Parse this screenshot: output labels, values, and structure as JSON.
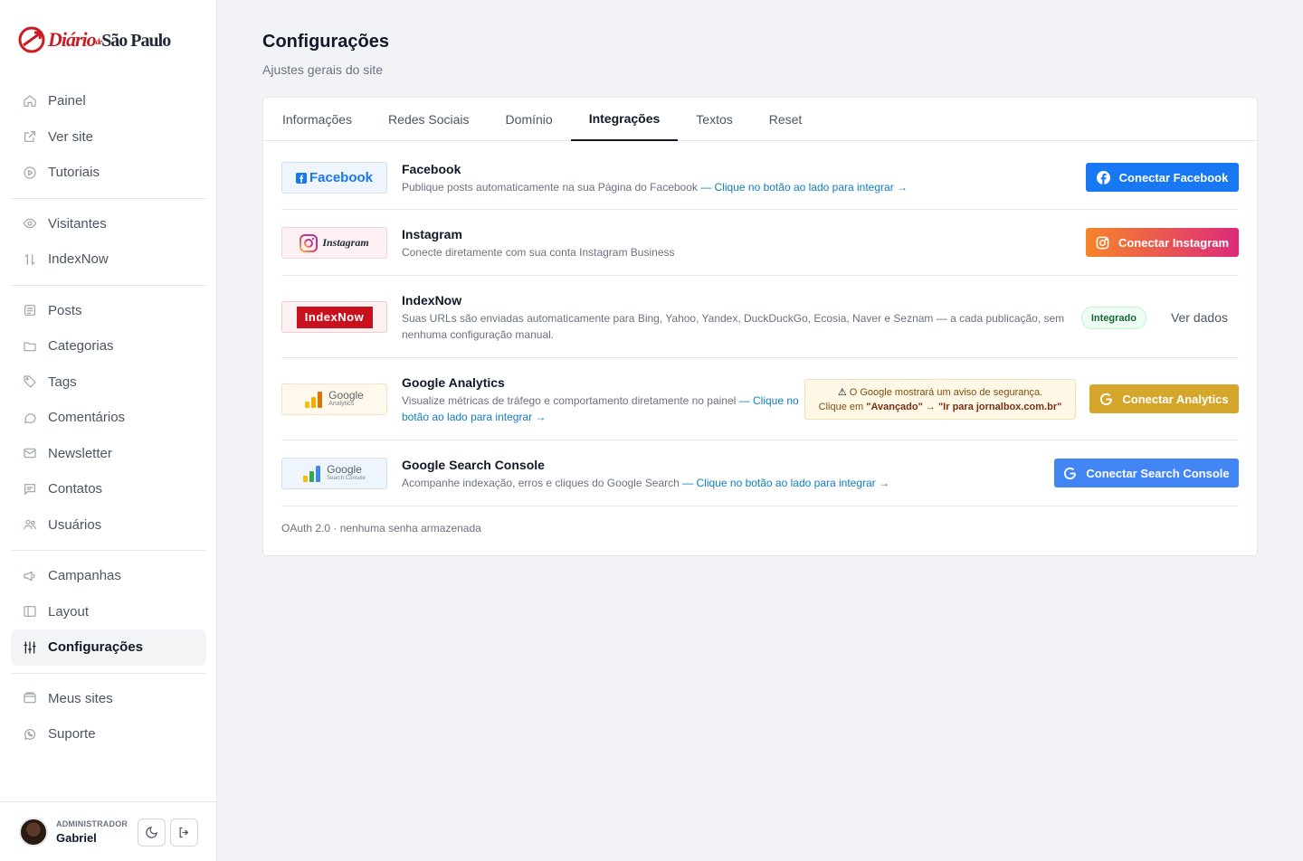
{
  "brand": {
    "name": "Diário",
    "connector": "de",
    "city": "São Paulo"
  },
  "nav": {
    "groups": [
      [
        {
          "label": "Painel",
          "icon": "home-icon"
        },
        {
          "label": "Ver site",
          "icon": "external-link-icon"
        },
        {
          "label": "Tutoriais",
          "icon": "play-circle-icon"
        }
      ],
      [
        {
          "label": "Visitantes",
          "icon": "eye-icon"
        },
        {
          "label": "IndexNow",
          "icon": "sort-arrows-icon"
        }
      ],
      [
        {
          "label": "Posts",
          "icon": "list-icon"
        },
        {
          "label": "Categorias",
          "icon": "folder-icon"
        },
        {
          "label": "Tags",
          "icon": "tag-icon"
        },
        {
          "label": "Comentários",
          "icon": "comment-icon"
        },
        {
          "label": "Newsletter",
          "icon": "mail-icon"
        },
        {
          "label": "Contatos",
          "icon": "message-square-icon"
        },
        {
          "label": "Usuários",
          "icon": "users-icon"
        }
      ],
      [
        {
          "label": "Campanhas",
          "icon": "megaphone-icon"
        },
        {
          "label": "Layout",
          "icon": "layout-icon"
        },
        {
          "label": "Configurações",
          "icon": "sliders-icon",
          "active": true
        }
      ],
      [
        {
          "label": "Meus sites",
          "icon": "browser-icon"
        },
        {
          "label": "Suporte",
          "icon": "whatsapp-icon"
        }
      ]
    ]
  },
  "user": {
    "role": "ADMINISTRADOR",
    "name": "Gabriel"
  },
  "page": {
    "title": "Configurações",
    "subtitle": "Ajustes gerais do site"
  },
  "tabs": [
    {
      "label": "Informações"
    },
    {
      "label": "Redes Sociais"
    },
    {
      "label": "Domínio"
    },
    {
      "label": "Integrações",
      "active": true
    },
    {
      "label": "Textos"
    },
    {
      "label": "Reset"
    }
  ],
  "integrations": {
    "facebook": {
      "badge": "Facebook",
      "title": "Facebook",
      "desc": "Publique posts automaticamente na sua Página do Facebook ",
      "link": "— Clique no botão ao lado para integrar →",
      "button": "Conectar Facebook",
      "color": "#1877f2"
    },
    "instagram": {
      "badge": "Instagram",
      "title": "Instagram",
      "desc": "Conecte diretamente com sua conta Instagram Business",
      "button": "Conectar Instagram"
    },
    "indexnow": {
      "badge": "IndexNow",
      "title": "IndexNow",
      "desc": "Suas URLs são enviadas automaticamente para Bing, Yahoo, Yandex, DuckDuckGo, Ecosia, Naver e Seznam — a cada publicação, sem nenhuma configuração manual.",
      "status": "Integrado",
      "action": "Ver dados"
    },
    "analytics": {
      "badge_brand": "Google",
      "badge_product": "Analytics",
      "title": "Google Analytics",
      "desc": "Visualize métricas de tráfego e comportamento diretamente no painel ",
      "link": "— Clique no botão ao lado para integrar →",
      "warning_line1": "O Google mostrará um aviso de segurança.",
      "warning_prefix": "Clique em ",
      "warning_step1": "\"Avançado\"",
      "warning_arrow": " → ",
      "warning_step2": "\"Ir para jornalbox.com.br\"",
      "button": "Conectar Analytics",
      "color": "#d4a72c"
    },
    "search_console": {
      "badge_brand": "Google",
      "badge_product": "Search Console",
      "title": "Google Search Console",
      "desc": "Acompanhe indexação, erros e cliques do Google Search ",
      "link": "— Clique no botão ao lado para integrar →",
      "button": "Conectar Search Console",
      "color": "#4285f4"
    }
  },
  "footer_note": "OAuth 2.0 · nenhuma senha armazenada"
}
